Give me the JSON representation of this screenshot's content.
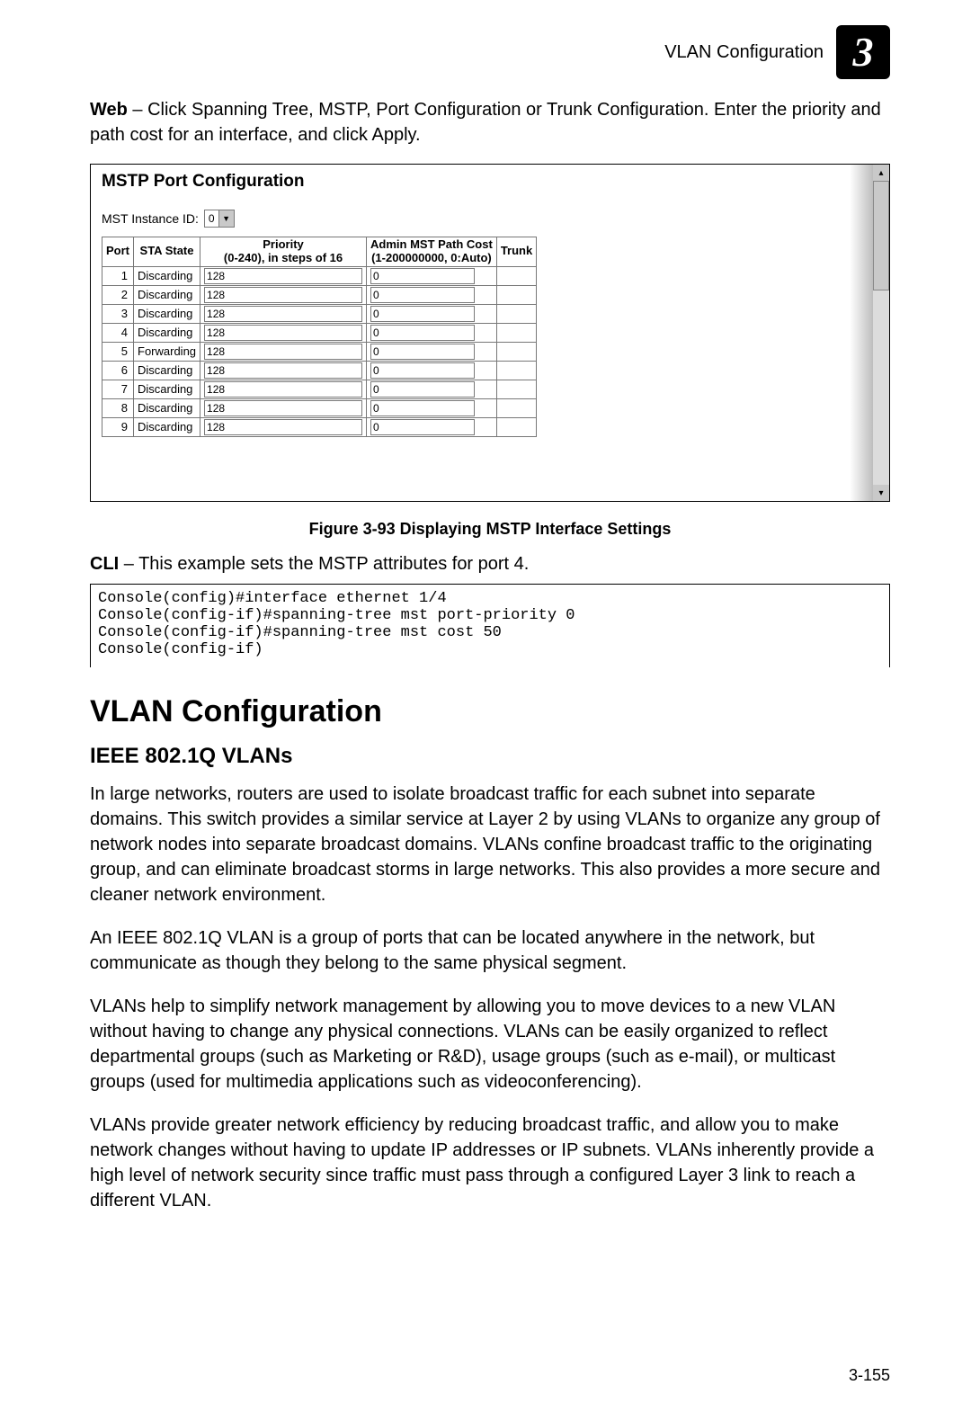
{
  "running_head": "VLAN Configuration",
  "chapter_num": "3",
  "web_intro": "Web – Click Spanning Tree, MSTP, Port Configuration or Trunk Configuration. Enter the priority and path cost for an interface, and click Apply.",
  "screenshot": {
    "title": "MSTP Port Configuration",
    "mst_label": "MST Instance ID:",
    "mst_value": "0",
    "headers": {
      "port": "Port",
      "sta": "STA State",
      "prio_line1": "Priority",
      "prio_line2": "(0-240), in steps of 16",
      "cost_line1": "Admin MST Path Cost",
      "cost_line2": "(1-200000000, 0:Auto)",
      "trunk": "Trunk"
    },
    "rows": [
      {
        "port": "1",
        "state": "Discarding",
        "prio": "128",
        "cost": "0",
        "trunk": ""
      },
      {
        "port": "2",
        "state": "Discarding",
        "prio": "128",
        "cost": "0",
        "trunk": ""
      },
      {
        "port": "3",
        "state": "Discarding",
        "prio": "128",
        "cost": "0",
        "trunk": ""
      },
      {
        "port": "4",
        "state": "Discarding",
        "prio": "128",
        "cost": "0",
        "trunk": ""
      },
      {
        "port": "5",
        "state": "Forwarding",
        "prio": "128",
        "cost": "0",
        "trunk": ""
      },
      {
        "port": "6",
        "state": "Discarding",
        "prio": "128",
        "cost": "0",
        "trunk": ""
      },
      {
        "port": "7",
        "state": "Discarding",
        "prio": "128",
        "cost": "0",
        "trunk": ""
      },
      {
        "port": "8",
        "state": "Discarding",
        "prio": "128",
        "cost": "0",
        "trunk": ""
      },
      {
        "port": "9",
        "state": "Discarding",
        "prio": "128",
        "cost": "0",
        "trunk": ""
      }
    ]
  },
  "figure_caption": "Figure 3-93  Displaying MSTP Interface Settings",
  "cli_intro": "CLI – This example sets the MSTP attributes for port 4.",
  "cli_block": "Console(config)#interface ethernet 1/4\nConsole(config-if)#spanning-tree mst port-priority 0\nConsole(config-if)#spanning-tree mst cost 50\nConsole(config-if)",
  "section_heading": "VLAN Configuration",
  "subsection_heading": "IEEE 802.1Q VLANs",
  "para1": "In large networks, routers are used to isolate broadcast traffic for each subnet into separate domains. This switch provides a similar service at Layer 2 by using VLANs to organize any group of network nodes into separate broadcast domains. VLANs confine broadcast traffic to the originating group, and can eliminate broadcast storms in large networks. This also provides a more secure and cleaner network environment.",
  "para2": "An IEEE 802.1Q VLAN is a group of ports that can be located anywhere in the network, but communicate as though they belong to the same physical segment.",
  "para3": "VLANs help to simplify network management by allowing you to move devices to a new VLAN without having to change any physical connections. VLANs can be easily organized to reflect departmental groups (such as Marketing or R&D), usage groups (such as e-mail), or multicast groups (used for multimedia applications such as videoconferencing).",
  "para4": "VLANs provide greater network efficiency by reducing broadcast traffic, and allow you to make network changes without having to update IP addresses or IP subnets. VLANs inherently provide a high level of network security since traffic must pass through a configured Layer 3 link to reach a different VLAN.",
  "page_number": "3-155"
}
